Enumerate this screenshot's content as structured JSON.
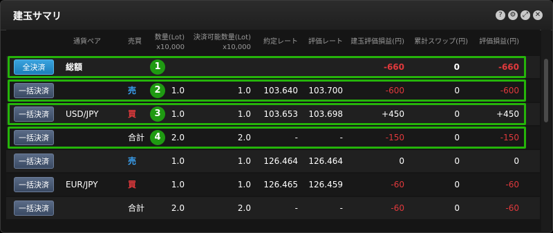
{
  "window": {
    "title": "建玉サマリ"
  },
  "header_icons": [
    "help-icon",
    "settings-icon",
    "expand-icon",
    "close-icon"
  ],
  "header_glyphs": {
    "help": "?",
    "settings": "⚙",
    "expand": "⤢",
    "close": "✕"
  },
  "columns": {
    "pair": "通貨ペア",
    "side": "売買",
    "qty": "数量(Lot)",
    "qty_unit": "x10,000",
    "settle_qty": "決済可能数量(Lot)",
    "settle_qty_unit": "x10,000",
    "rate": "約定レート",
    "eval_rate": "評価レート",
    "pl": "建玉評価損益(円)",
    "swap": "累計スワップ(円)",
    "eval_pl": "評価損益(円)"
  },
  "total_row": {
    "button": "全決済",
    "label": "総額",
    "pl": "-660",
    "swap": "0",
    "eval_pl": "-660"
  },
  "rows": [
    {
      "button": "一括決済",
      "pair": "",
      "side": "売",
      "side_type": "sell",
      "qty": "1.0",
      "settle_qty": "1.0",
      "rate": "103.640",
      "eval_rate": "103.700",
      "pl": "-600",
      "pl_neg": true,
      "swap": "0",
      "eval_pl": "-600",
      "eval_neg": true
    },
    {
      "button": "一括決済",
      "pair": "USD/JPY",
      "side": "買",
      "side_type": "buy",
      "qty": "1.0",
      "settle_qty": "1.0",
      "rate": "103.653",
      "eval_rate": "103.698",
      "pl": "+450",
      "pl_neg": false,
      "swap": "0",
      "eval_pl": "+450",
      "eval_neg": false
    },
    {
      "button": "一括決済",
      "pair": "",
      "side": "合計",
      "side_type": "total",
      "qty": "2.0",
      "settle_qty": "2.0",
      "rate": "-",
      "eval_rate": "-",
      "pl": "-150",
      "pl_neg": true,
      "swap": "0",
      "eval_pl": "-150",
      "eval_neg": true
    },
    {
      "button": "一括決済",
      "pair": "",
      "side": "売",
      "side_type": "sell",
      "qty": "1.0",
      "settle_qty": "1.0",
      "rate": "126.464",
      "eval_rate": "126.464",
      "pl": "0",
      "pl_neg": false,
      "swap": "0",
      "eval_pl": "0",
      "eval_neg": false
    },
    {
      "button": "一括決済",
      "pair": "EUR/JPY",
      "side": "買",
      "side_type": "buy",
      "qty": "1.0",
      "settle_qty": "1.0",
      "rate": "126.465",
      "eval_rate": "126.459",
      "pl": "-60",
      "pl_neg": true,
      "swap": "0",
      "eval_pl": "-60",
      "eval_neg": true
    },
    {
      "button": "一括決済",
      "pair": "",
      "side": "合計",
      "side_type": "total",
      "qty": "2.0",
      "settle_qty": "2.0",
      "rate": "-",
      "eval_rate": "-",
      "pl": "-60",
      "pl_neg": true,
      "swap": "0",
      "eval_pl": "-60",
      "eval_neg": true
    }
  ],
  "annotations": [
    "1",
    "2",
    "3",
    "4"
  ],
  "colors": {
    "negative": "#e0393c",
    "sell": "#3aa0f0",
    "buy": "#e0393c",
    "highlight": "#25b40a"
  }
}
